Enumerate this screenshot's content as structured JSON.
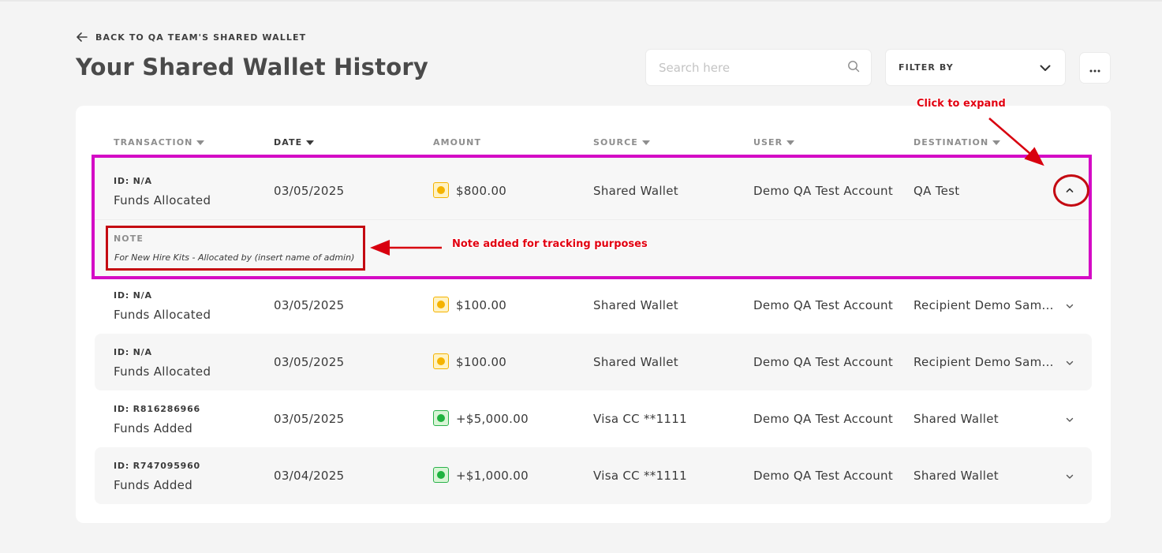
{
  "back_link": {
    "label": "BACK TO QA TEAM'S SHARED WALLET",
    "icon": "arrow-left-icon"
  },
  "page_title": "Your Shared Wallet History",
  "search": {
    "placeholder": "Search here",
    "value": "",
    "icon": "search-icon"
  },
  "filter": {
    "label": "FILTER BY",
    "icon": "chevron-down-icon"
  },
  "more_menu": {
    "icon": "more-horizontal-icon"
  },
  "table": {
    "columns": [
      {
        "label": "TRANSACTION",
        "sortable": true,
        "active": false
      },
      {
        "label": "DATE",
        "sortable": true,
        "active": true
      },
      {
        "label": "AMOUNT",
        "sortable": false,
        "active": false
      },
      {
        "label": "SOURCE",
        "sortable": true,
        "active": false
      },
      {
        "label": "USER",
        "sortable": true,
        "active": false
      },
      {
        "label": "DESTINATION",
        "sortable": true,
        "active": false
      }
    ],
    "rows": [
      {
        "id": "ID: N/A",
        "type": "Funds Allocated",
        "date": "03/05/2025",
        "amount": "$800.00",
        "status_color": "yellow",
        "source": "Shared Wallet",
        "user": "Demo QA Test Account",
        "destination": "QA Test",
        "expanded": true,
        "note_label": "NOTE",
        "note": "For New Hire Kits - Allocated by (insert name of admin)"
      },
      {
        "id": "ID: N/A",
        "type": "Funds Allocated",
        "date": "03/05/2025",
        "amount": "$100.00",
        "status_color": "yellow",
        "source": "Shared Wallet",
        "user": "Demo QA Test Account",
        "destination": "Recipient Demo Sam...",
        "expanded": false
      },
      {
        "id": "ID: N/A",
        "type": "Funds Allocated",
        "date": "03/05/2025",
        "amount": "$100.00",
        "status_color": "yellow",
        "source": "Shared Wallet",
        "user": "Demo QA Test Account",
        "destination": "Recipient Demo Sam...",
        "expanded": false
      },
      {
        "id": "ID: R816286966",
        "type": "Funds Added",
        "date": "03/05/2025",
        "amount": "+$5,000.00",
        "status_color": "green",
        "source": "Visa CC **1111",
        "user": "Demo QA Test Account",
        "destination": "Shared Wallet",
        "expanded": false
      },
      {
        "id": "ID: R747095960",
        "type": "Funds Added",
        "date": "03/04/2025",
        "amount": "+$1,000.00",
        "status_color": "green",
        "source": "Visa CC **1111",
        "user": "Demo QA Test Account",
        "destination": "Shared Wallet",
        "expanded": false
      }
    ]
  },
  "annotations": {
    "expand_callout": "Click to expand",
    "note_callout": "Note added for tracking purposes",
    "colors": {
      "magenta": "#d40bc5",
      "red": "#c40a12",
      "text_red": "#e20010"
    }
  },
  "colors": {
    "status_yellow": "#f5b300",
    "status_green": "#1fb33f",
    "row_alt": "#f6f6f6"
  }
}
